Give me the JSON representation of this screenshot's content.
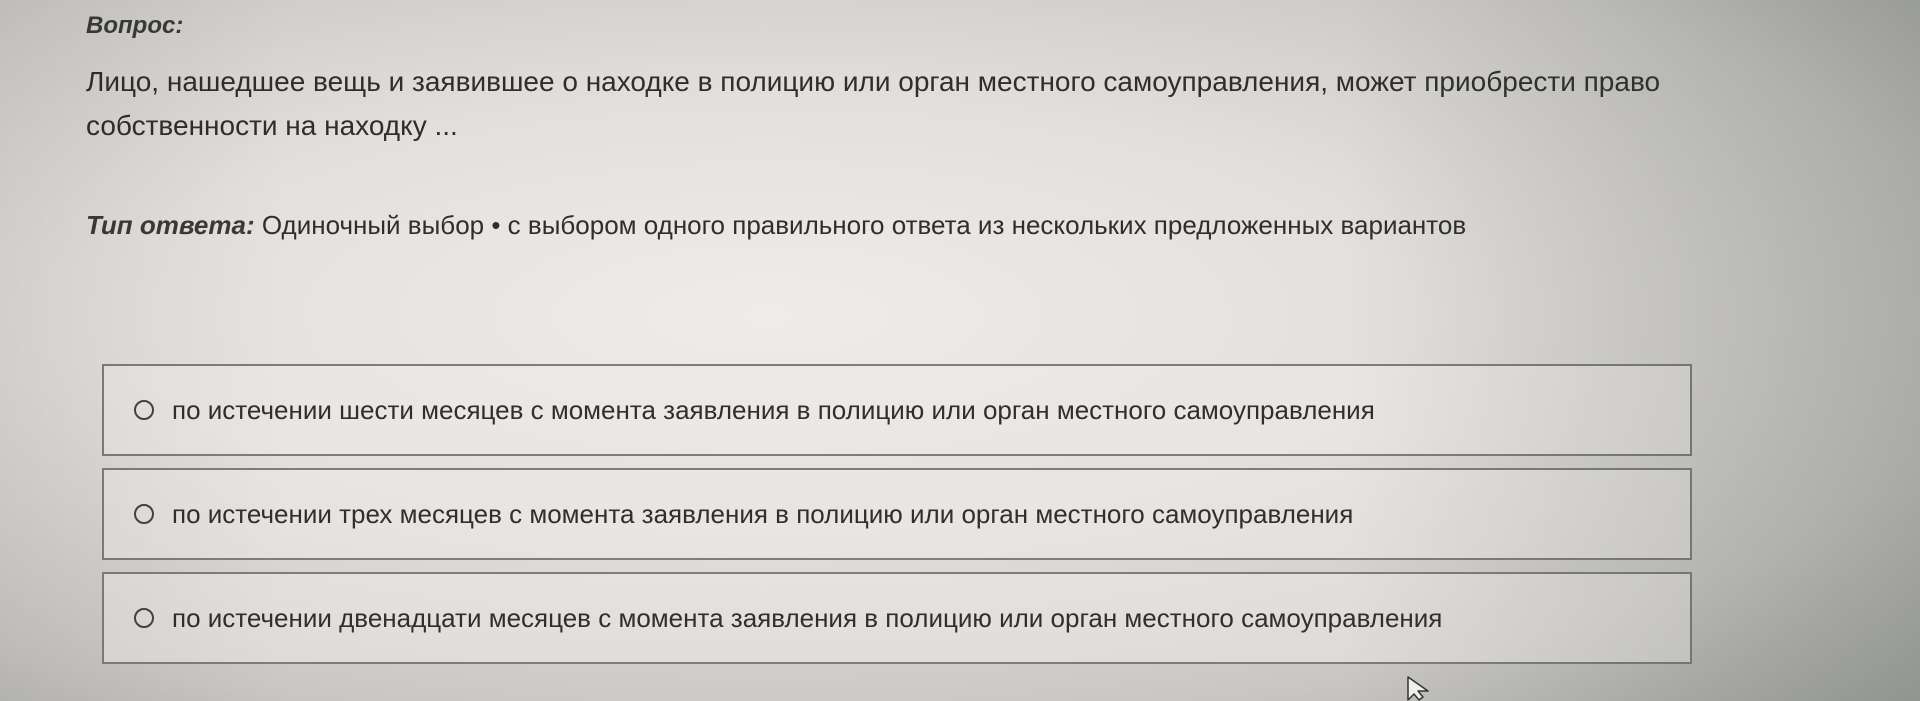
{
  "question": {
    "label": "Вопрос:",
    "text": "Лицо, нашедшее вещь и заявившее о находке в полицию или орган местного самоуправления, может приобрести право собственности на находку ..."
  },
  "answer_type": {
    "label": "Тип ответа:",
    "value": "Одиночный выбор • с выбором одного правильного ответа из нескольких предложенных вариантов"
  },
  "options": [
    {
      "label": "по истечении шести месяцев с момента заявления в полицию или орган местного самоуправления"
    },
    {
      "label": "по истечении трех месяцев с момента заявления в полицию или орган местного самоуправления"
    },
    {
      "label": "по истечении двенадцати месяцев с момента заявления в полицию или орган местного самоуправления"
    }
  ],
  "icons": {
    "radio": "radio-unselected-icon",
    "cursor": "mouse-pointer-icon"
  }
}
